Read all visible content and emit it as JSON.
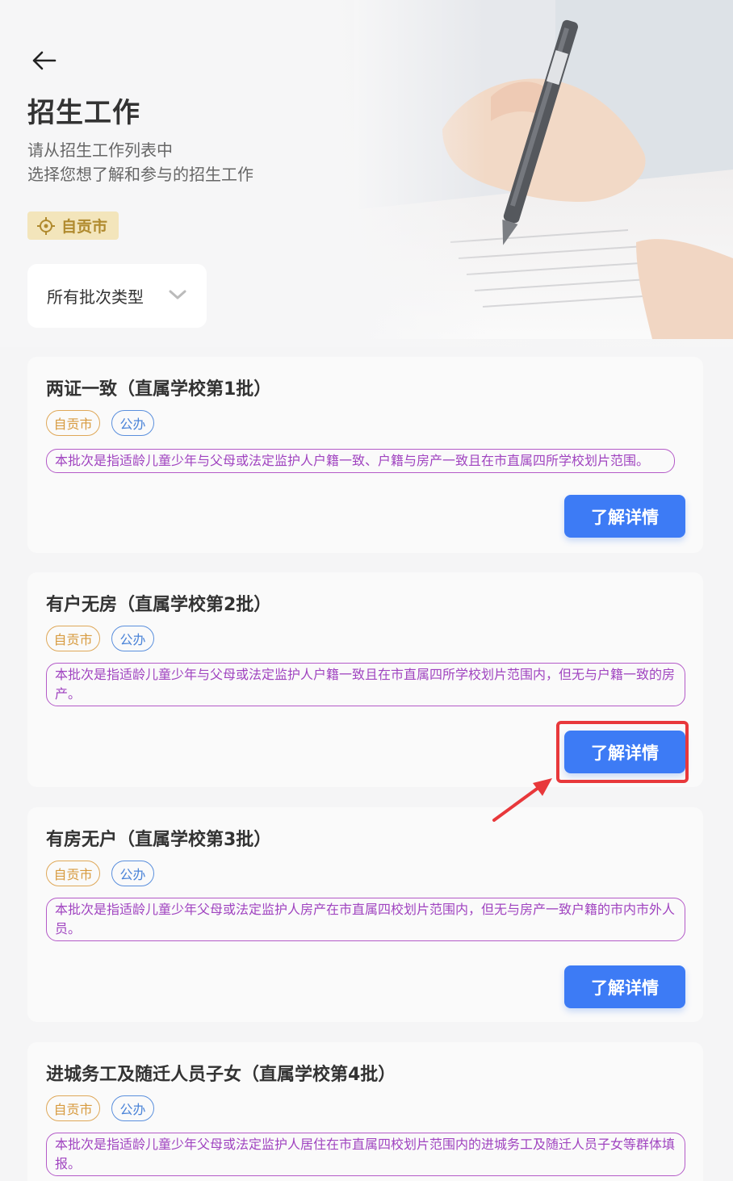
{
  "header": {
    "title": "招生工作",
    "subtitle_line1": "请从招生工作列表中",
    "subtitle_line2": "选择您想了解和参与的招生工作",
    "location": "自贡市"
  },
  "filter": {
    "label": "所有批次类型"
  },
  "cards": [
    {
      "title": "两证一致（直属学校第1批）",
      "tag_city": "自贡市",
      "tag_type": "公办",
      "description": "本批次是指适龄儿童少年与父母或法定监护人户籍一致、户籍与房产一致且在市直属四所学校划片范围。",
      "button": "了解详情"
    },
    {
      "title": "有户无房（直属学校第2批）",
      "tag_city": "自贡市",
      "tag_type": "公办",
      "description": "本批次是指适龄儿童少年与父母或法定监护人户籍一致且在市直属四所学校划片范围内，但无与户籍一致的房产。",
      "button": "了解详情"
    },
    {
      "title": "有房无户（直属学校第3批）",
      "tag_city": "自贡市",
      "tag_type": "公办",
      "description": "本批次是指适龄儿童少年父母或法定监护人房产在市直属四校划片范围内，但无与房产一致户籍的市内市外人员。",
      "button": "了解详情"
    },
    {
      "title": "进城务工及随迁人员子女（直属学校第4批）",
      "tag_city": "自贡市",
      "tag_type": "公办",
      "description": "本批次是指适龄儿童少年父母或法定监护人居住在市直属四校划片范围内的进城务工及随迁人员子女等群体填报。"
    }
  ],
  "colors": {
    "accent_blue": "#3d7bf5",
    "tag_city": "#d79a3e",
    "tag_public": "#4b84d8",
    "desc_purple": "#a044c0",
    "annotation_red": "#e8383b"
  },
  "icons": {
    "back": "arrow-left-icon",
    "location": "location-target-icon",
    "dropdown": "chevron-down-icon"
  }
}
